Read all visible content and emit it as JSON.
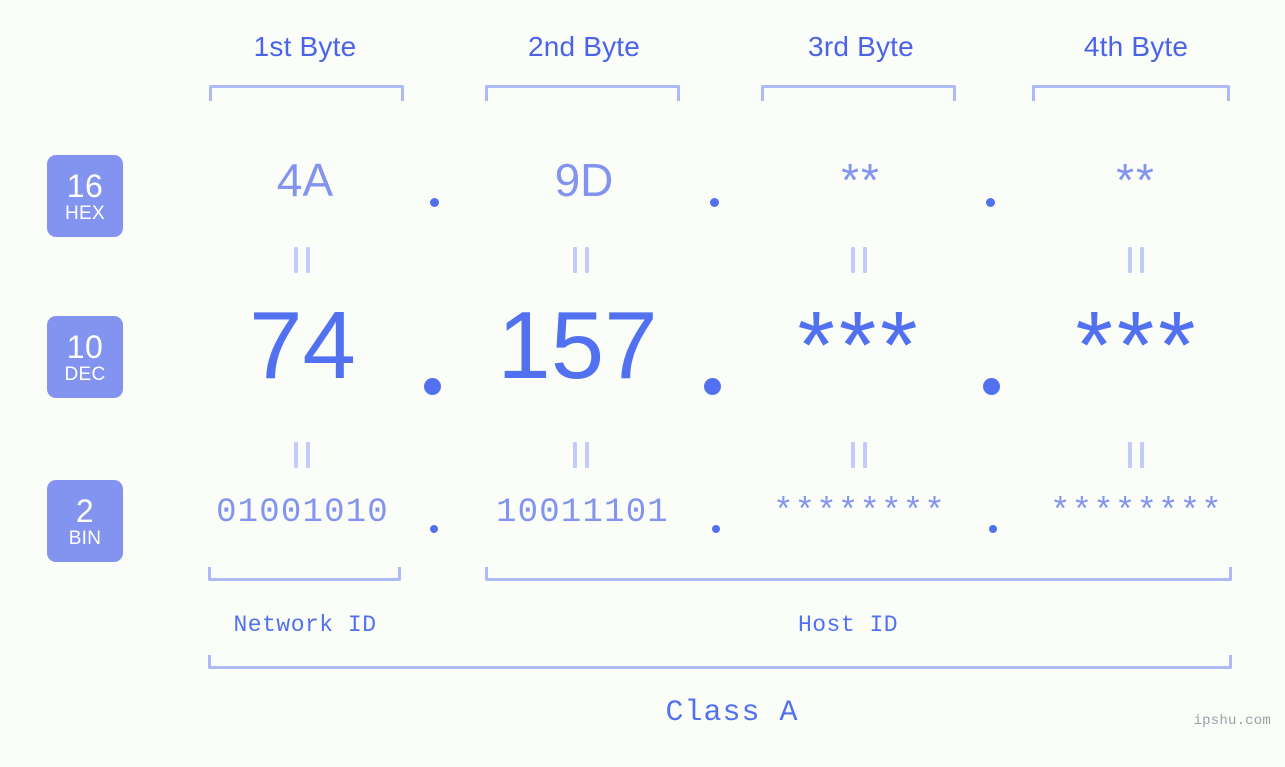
{
  "ip": {
    "class": "Class A",
    "network_id_label": "Network ID",
    "host_id_label": "Host ID"
  },
  "byte_headers": [
    {
      "label": "1st Byte"
    },
    {
      "label": "2nd Byte"
    },
    {
      "label": "3rd Byte"
    },
    {
      "label": "4th Byte"
    }
  ],
  "bases": [
    {
      "num": "16",
      "sub": "HEX"
    },
    {
      "num": "10",
      "sub": "DEC"
    },
    {
      "num": "2",
      "sub": "BIN"
    }
  ],
  "rows": {
    "hex": {
      "base_num": "16",
      "base_sub": "HEX",
      "values": [
        "4A",
        "9D",
        "**",
        "**"
      ]
    },
    "dec": {
      "base_num": "10",
      "base_sub": "DEC",
      "values": [
        "74",
        "157",
        "***",
        "***"
      ]
    },
    "bin": {
      "base_num": "2",
      "base_sub": "BIN",
      "values": [
        "01001010",
        "10011101",
        "********",
        "********"
      ]
    }
  },
  "separators": {
    "hex": [
      ".",
      ".",
      "."
    ],
    "dec": [
      ".",
      ".",
      "."
    ],
    "bin": [
      ".",
      ".",
      "."
    ]
  },
  "equals_marks": {
    "symbol": "="
  },
  "watermark": "ipshu.com",
  "colors": {
    "background": "#fbfdf8",
    "accent_strong": "#5271f0",
    "accent_mid": "#8294f0",
    "accent_light": "#aeb9f7",
    "accent_pale": "#c3cbf9",
    "badge_bg": "#8294f0",
    "badge_text": "#ffffff",
    "watermark_text": "#9aa0a8"
  }
}
